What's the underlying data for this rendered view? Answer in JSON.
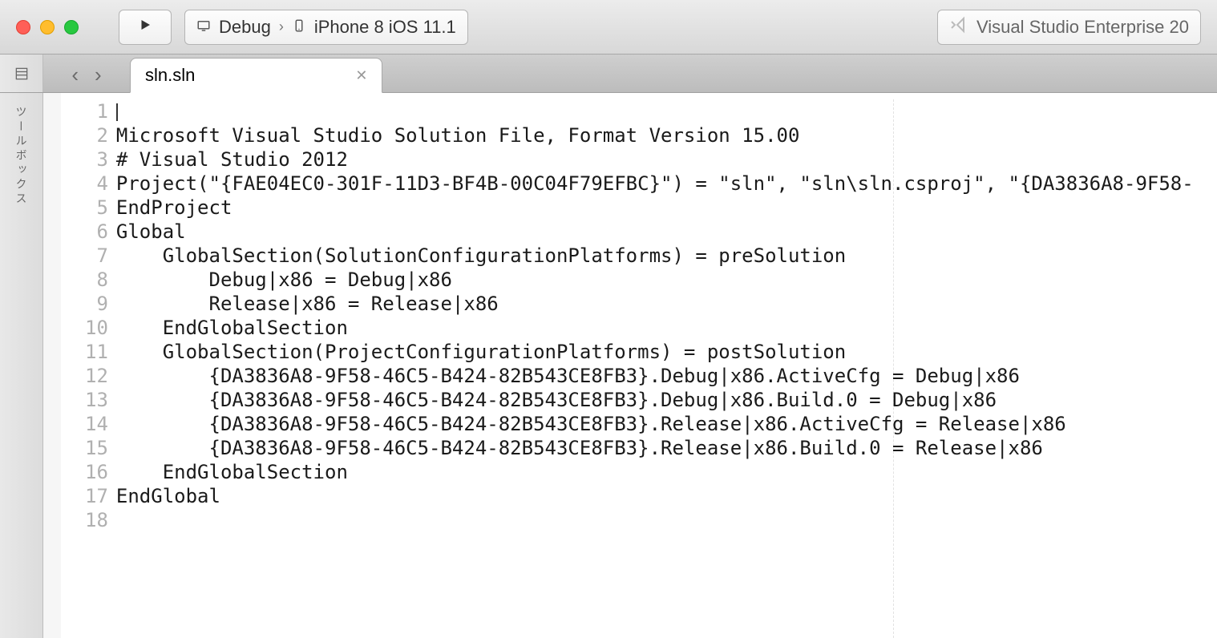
{
  "titlebar": {
    "config_label": "Debug",
    "target_label": "iPhone 8 iOS 11.1",
    "product_label": "Visual Studio Enterprise 20"
  },
  "tab": {
    "name": "sln.sln"
  },
  "sidebar": {
    "toolbox_label": "ツールボックス"
  },
  "code": {
    "lines": [
      "",
      "Microsoft Visual Studio Solution File, Format Version 15.00",
      "# Visual Studio 2012",
      "Project(\"{FAE04EC0-301F-11D3-BF4B-00C04F79EFBC}\") = \"sln\", \"sln\\sln.csproj\", \"{DA3836A8-9F58-",
      "EndProject",
      "Global",
      "    GlobalSection(SolutionConfigurationPlatforms) = preSolution",
      "        Debug|x86 = Debug|x86",
      "        Release|x86 = Release|x86",
      "    EndGlobalSection",
      "    GlobalSection(ProjectConfigurationPlatforms) = postSolution",
      "        {DA3836A8-9F58-46C5-B424-82B543CE8FB3}.Debug|x86.ActiveCfg = Debug|x86",
      "        {DA3836A8-9F58-46C5-B424-82B543CE8FB3}.Debug|x86.Build.0 = Debug|x86",
      "        {DA3836A8-9F58-46C5-B424-82B543CE8FB3}.Release|x86.ActiveCfg = Release|x86",
      "        {DA3836A8-9F58-46C5-B424-82B543CE8FB3}.Release|x86.Build.0 = Release|x86",
      "    EndGlobalSection",
      "EndGlobal",
      ""
    ]
  }
}
